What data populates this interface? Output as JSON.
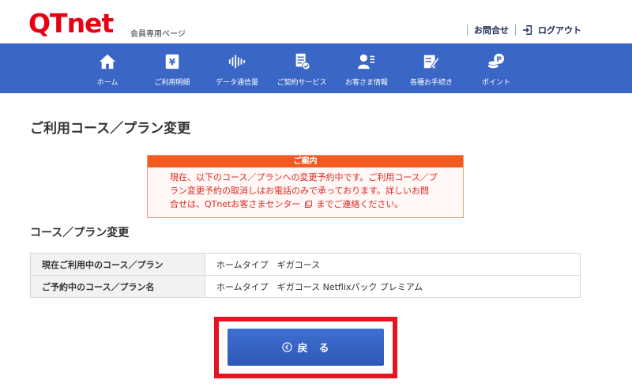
{
  "header": {
    "logo": "QTnet",
    "logo_sub": "会員専用ページ",
    "contact_label": "お問合せ",
    "logout_label": "ログアウト"
  },
  "nav": {
    "items": [
      {
        "label": "ホーム",
        "icon": "home-icon"
      },
      {
        "label": "ご利用明細",
        "icon": "billing-icon"
      },
      {
        "label": "データ通信量",
        "icon": "data-usage-icon"
      },
      {
        "label": "ご契約サービス",
        "icon": "contract-icon"
      },
      {
        "label": "お客さま情報",
        "icon": "customer-icon"
      },
      {
        "label": "各種お手続き",
        "icon": "procedure-icon"
      },
      {
        "label": "ポイント",
        "icon": "points-icon"
      }
    ]
  },
  "page_title": "ご利用コース／プラン変更",
  "notice": {
    "heading": "ご案内",
    "line1": "現在、以下のコース／プランへの変更予約中です。ご利用コース／プ",
    "line2": "ラン変更予約の取消しはお電話のみで承っております。詳しいお問",
    "line3_a": "合せは、QTnetお客さまセンター",
    "line3_b": "までご連絡ください。"
  },
  "section_title": "コース／プラン変更",
  "table": {
    "rows": [
      {
        "label": "現在ご利用中のコース／プラン",
        "value": "ホームタイプ　ギガコース"
      },
      {
        "label": "ご予約中のコース／プラン名",
        "value": "ホームタイプ　ギガコース Netflixパック プレミアム"
      }
    ]
  },
  "back_button": {
    "label": "戻る"
  },
  "colors": {
    "brand_red": "#e60012",
    "nav_blue": "#3a66c6",
    "notice_orange": "#f25a22",
    "highlight_red": "#e21520"
  }
}
